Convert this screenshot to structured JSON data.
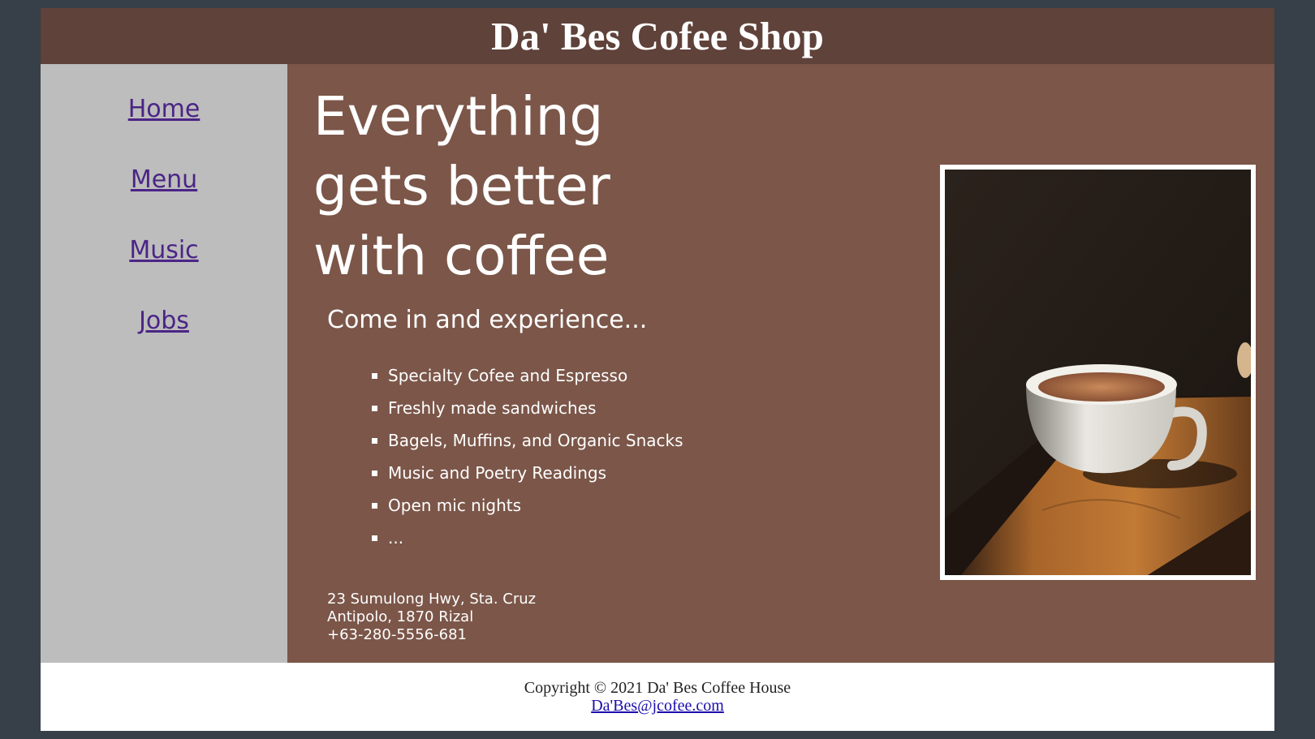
{
  "header": {
    "title": "Da' Bes Cofee Shop"
  },
  "nav": {
    "items": [
      {
        "label": "Home"
      },
      {
        "label": "Menu"
      },
      {
        "label": "Music"
      },
      {
        "label": "Jobs"
      }
    ],
    "link_color": "#4b2586"
  },
  "hero": {
    "headline": "Everything gets better with coffee",
    "subheading": "Come in and experience...",
    "features": [
      "Specialty Cofee and Espresso",
      "Freshly made sandwiches",
      "Bagels, Muffins, and Organic Snacks",
      "Music and Poetry Readings",
      "Open mic nights",
      "..."
    ]
  },
  "address": {
    "line1": "23 Sumulong Hwy, Sta. Cruz",
    "line2": "Antipolo, 1870 Rizal",
    "phone": "+63-280-5556-681"
  },
  "photo": {
    "subject": "coffee-cup"
  },
  "footer": {
    "copyright": "Copyright © 2021 Da' Bes Coffee House",
    "email": "Da'Bes@jcofee.com"
  },
  "colors": {
    "background": "#373f48",
    "header": "#5f423a",
    "sidebar": "#bdbdbd",
    "main": "#7b5649",
    "footer": "#ffffff"
  }
}
